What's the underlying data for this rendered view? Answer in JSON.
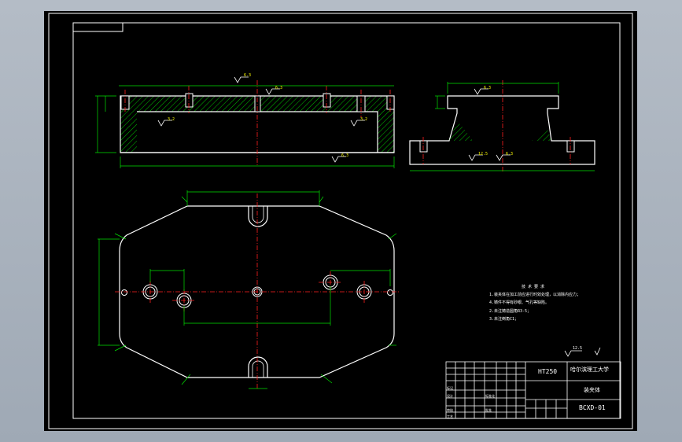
{
  "drawing": {
    "tech_requirements": {
      "title": "技 术 要 求",
      "lines": [
        "1.装夹体在加工前应进行时效处理，以消除内应力；",
        "2.未注铸造圆角R3-5；",
        "3.未注倒角C1；",
        "4.铸件不得有砂眼、气孔等缺陷。"
      ]
    },
    "surface_labels": [
      "6.3",
      "6.3",
      "3.2",
      "3.2",
      "6.3",
      "6.3",
      "12.5",
      "6.3",
      "6.3",
      "6.3"
    ],
    "roughness_general": "12.5",
    "title_block": {
      "material": "HT250",
      "school": "哈尔滨理工大学",
      "part_name": "装夹体",
      "drawing_no": "BCXD-01",
      "left_labels": [
        "标记",
        "设计",
        "审核",
        "工艺"
      ],
      "mid_labels": [
        "标准化",
        "批准"
      ]
    },
    "colors": {
      "outline": "#ffffff",
      "dimension": "#00e000",
      "centerline": "#ff2020",
      "hatch": "#00c000",
      "label": "#ffff00",
      "background": "#000000"
    }
  }
}
